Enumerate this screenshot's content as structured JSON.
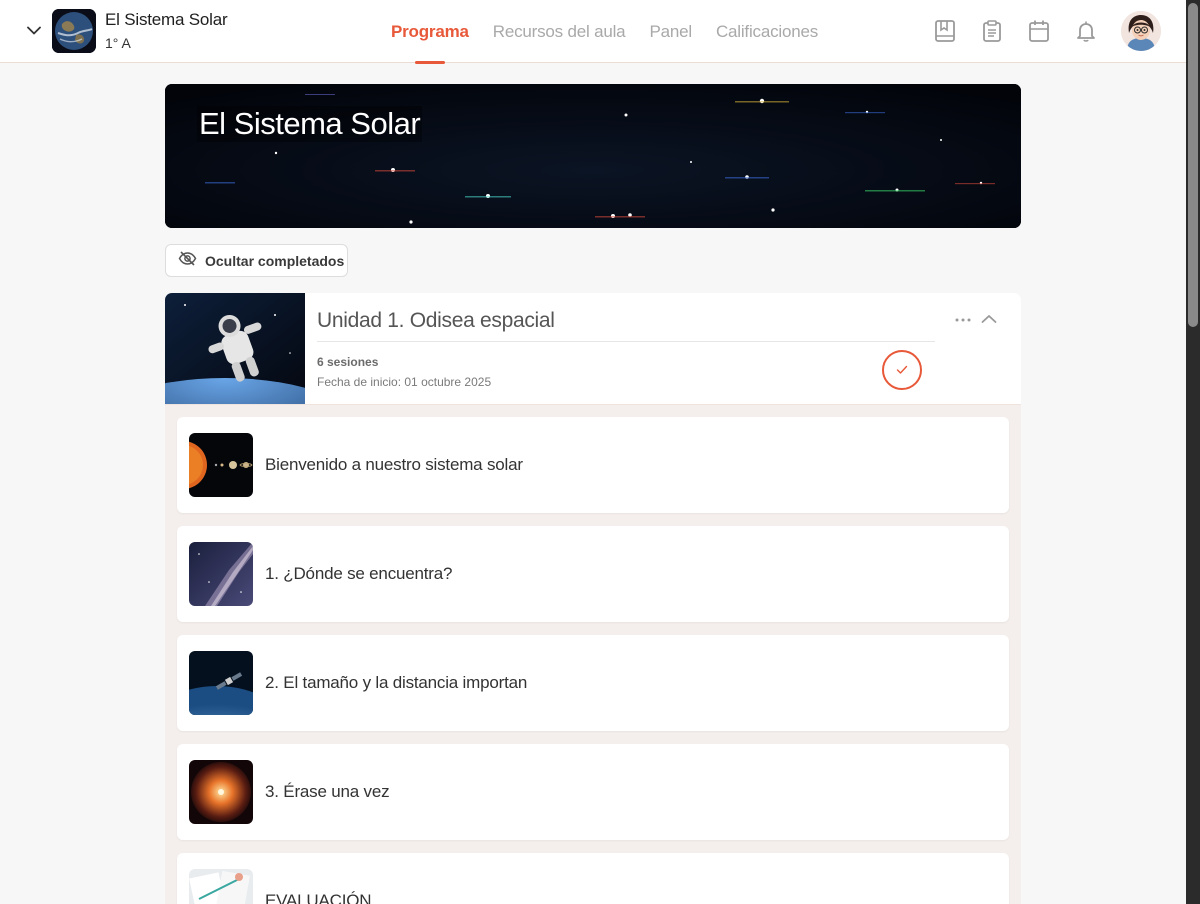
{
  "header": {
    "course_title": "El Sistema Solar",
    "course_group": "1° A",
    "tabs": [
      {
        "label": "Programa",
        "active": true
      },
      {
        "label": "Recursos del aula",
        "active": false
      },
      {
        "label": "Panel",
        "active": false
      },
      {
        "label": "Calificaciones",
        "active": false
      }
    ],
    "icons": [
      "bookmark-book-icon",
      "clipboard-icon",
      "calendar-icon",
      "bell-icon"
    ],
    "accent_color": "#e8593a"
  },
  "banner": {
    "title": "El Sistema Solar"
  },
  "filter": {
    "hide_completed_label": "Ocultar completados"
  },
  "unit": {
    "title": "Unidad 1. Odisea espacial",
    "sessions_label": "6 sesiones",
    "start_date_label": "Fecha de inicio: 01 octubre 2025",
    "completed": true,
    "sessions": [
      {
        "name": "Bienvenido a nuestro sistema solar"
      },
      {
        "name": "1. ¿Dónde se encuentra?"
      },
      {
        "name": "2. El tamaño y la distancia importan"
      },
      {
        "name": "3. Érase una vez"
      },
      {
        "name": "EVALUACIÓN"
      }
    ]
  }
}
